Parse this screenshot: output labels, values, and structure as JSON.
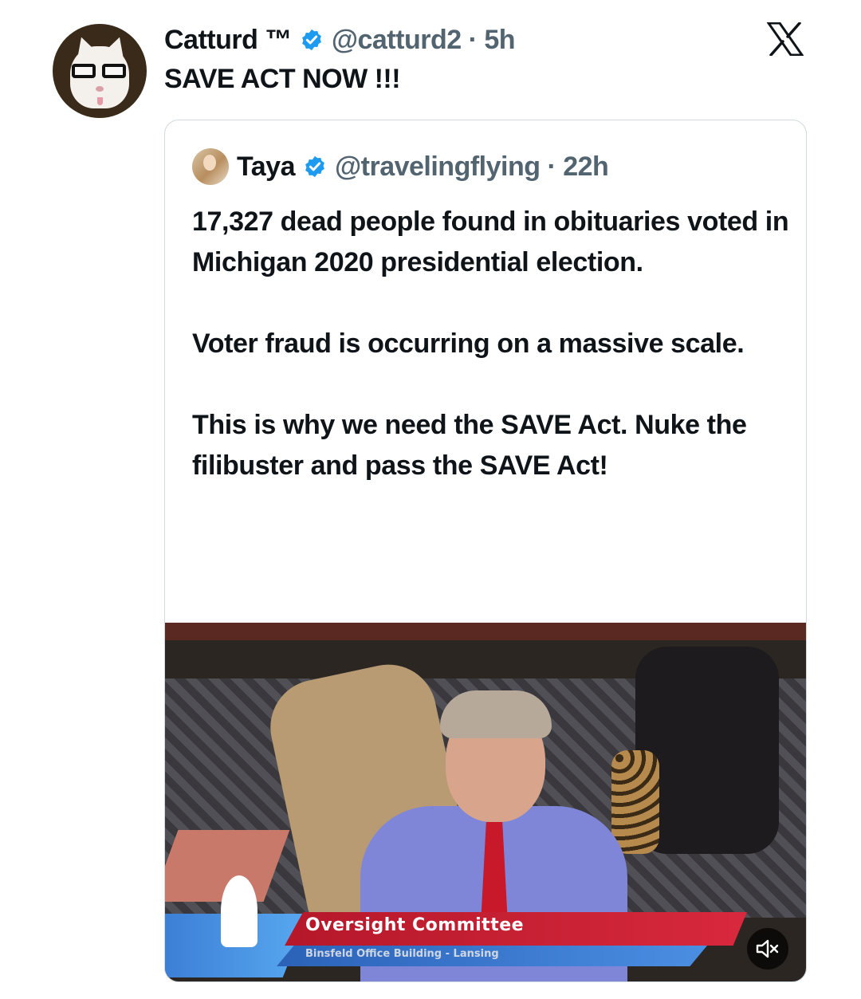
{
  "tweet": {
    "author_name": "Catturd ™",
    "handle_time": "@catturd2 · 5h",
    "text": "SAVE ACT NOW !!!",
    "avatar_icon": "cat-with-glasses-avatar"
  },
  "app": {
    "logo_icon": "x-logo"
  },
  "quote": {
    "author_name": "Taya",
    "handle_time": "@travelingflying · 22h",
    "paragraphs": [
      "17,327 dead people found in obituaries voted in Michigan 2020 presidential election.",
      "Voter fraud is occurring on a massive scale.",
      "This is why we need the SAVE Act. Nuke the filibuster and pass the SAVE Act!"
    ],
    "video": {
      "lower_third_title": "Oversight Committee",
      "lower_third_subtitle": "Binsfeld Office Building - Lansing",
      "mute_icon": "volume-muted-icon"
    }
  },
  "colors": {
    "verified_blue": "#1d9bf0",
    "handle_gray": "#536471",
    "text": "#0f1419"
  }
}
